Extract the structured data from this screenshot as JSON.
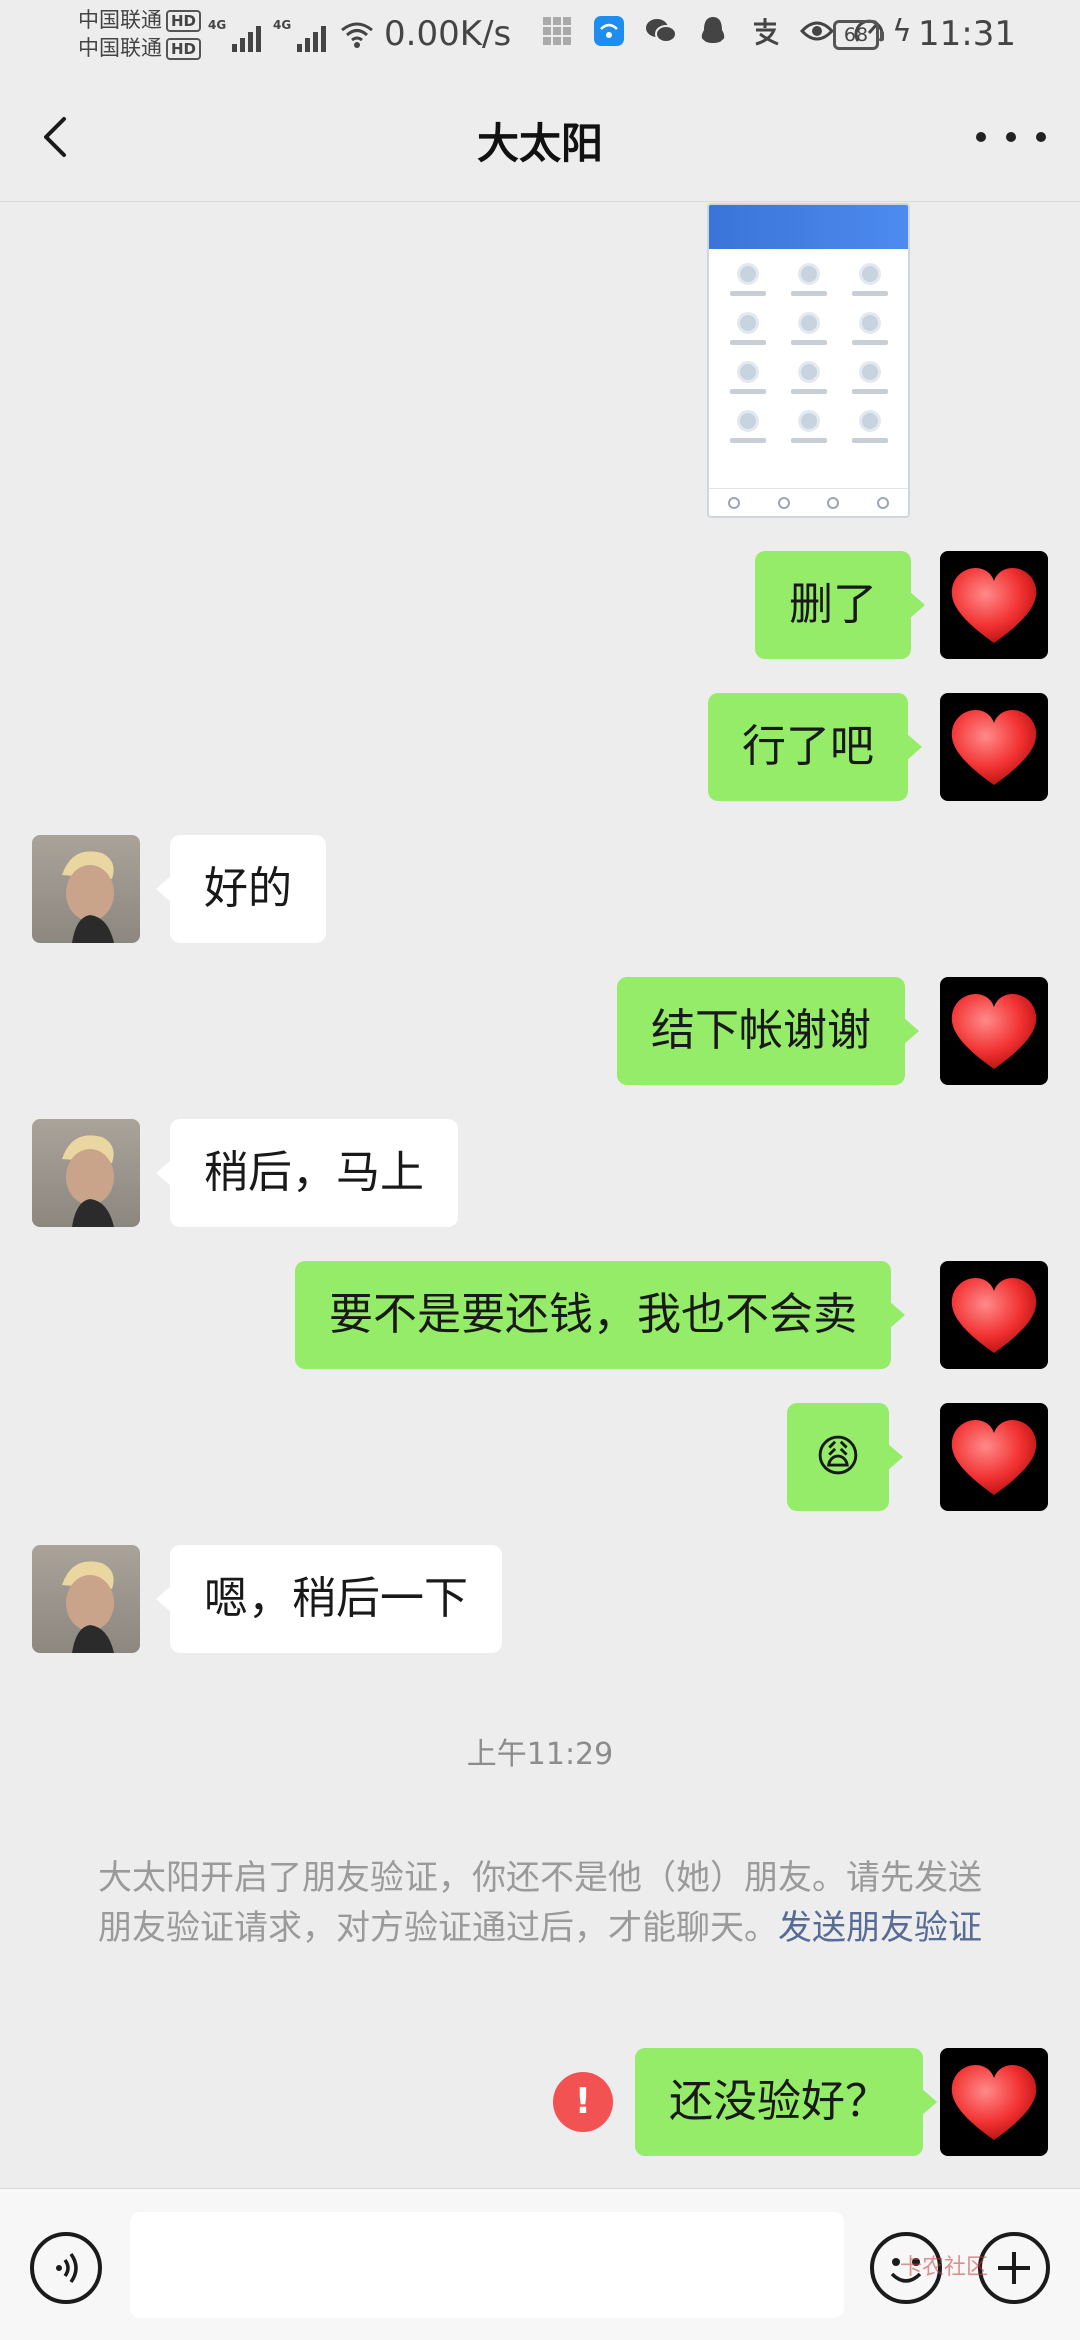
{
  "status_bar": {
    "carrier_1": "中国联通",
    "carrier_2": "中国联通",
    "hd_badge": "HD",
    "network_1": "4G",
    "network_2": "4G",
    "net_speed": "0.00K/s",
    "battery": "68",
    "time": "11:31"
  },
  "header": {
    "back_icon": "chevron-left-icon",
    "title": "大太阳",
    "more_icon": "more-dots-icon"
  },
  "messages": [
    {
      "from": "me",
      "type": "image"
    },
    {
      "from": "me",
      "text": "删了"
    },
    {
      "from": "me",
      "text": "行了吧"
    },
    {
      "from": "other",
      "text": "好的"
    },
    {
      "from": "me",
      "text": "结下帐谢谢"
    },
    {
      "from": "other",
      "text": "稍后，马上"
    },
    {
      "from": "me",
      "text": "要不是要还钱，我也不会卖"
    },
    {
      "from": "me",
      "text": "😩"
    },
    {
      "from": "other",
      "text": "嗯，稍后一下"
    }
  ],
  "timestamp": "上午11:29",
  "system_notice": {
    "text": "大太阳开启了朋友验证，你还不是他（她）朋友。请先发送朋友验证请求，对方验证通过后，才能聊天。",
    "link": "发送朋友验证"
  },
  "last_message": {
    "from": "me",
    "text": "还没验好？",
    "error_mark": "!"
  },
  "input_bar": {
    "voice_icon": "voice-icon",
    "emoji_icon": "emoji-icon",
    "plus_icon": "plus-icon",
    "input_value": ""
  },
  "watermark": "卡农社区"
}
